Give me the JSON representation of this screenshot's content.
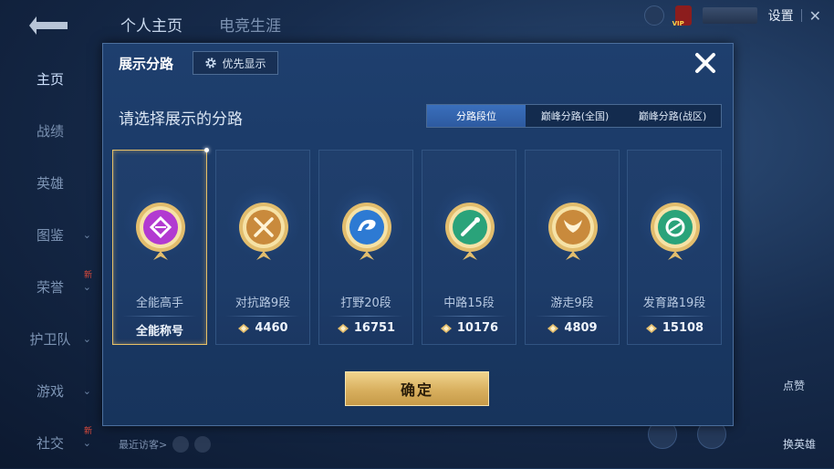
{
  "top_tabs": [
    "个人主页",
    "电竞生涯"
  ],
  "settings_label": "设置",
  "vip_label": "VIP",
  "sidebar": [
    {
      "label": "主页",
      "has_chevron": false
    },
    {
      "label": "战绩",
      "has_chevron": false
    },
    {
      "label": "英雄",
      "has_chevron": false
    },
    {
      "label": "图鉴",
      "has_chevron": true
    },
    {
      "label": "荣誉",
      "has_chevron": true,
      "badge": "新"
    },
    {
      "label": "护卫队",
      "has_chevron": true
    },
    {
      "label": "游戏",
      "has_chevron": true
    },
    {
      "label": "社交",
      "has_chevron": true,
      "badge": "新"
    }
  ],
  "recent_visitors_label": "最近访客>",
  "right_labels": [
    "点赞",
    "换英雄"
  ],
  "modal": {
    "title": "展示分路",
    "priority_label": "优先显示",
    "subtitle": "请选择展示的分路",
    "segments": [
      {
        "label": "分路段位",
        "active": true
      },
      {
        "label": "巅峰分路(全国)",
        "active": false
      },
      {
        "label": "巅峰分路(战区)",
        "active": false
      }
    ],
    "cards": [
      {
        "name": "全能高手",
        "value": "全能称号",
        "show_points_icon": false,
        "selected": true,
        "badge_color": "#b23ad1",
        "icon": "diamond-icon"
      },
      {
        "name": "对抗路9段",
        "value": "4460",
        "show_points_icon": true,
        "selected": false,
        "badge_color": "#c98a3c",
        "icon": "crossed-swords-icon"
      },
      {
        "name": "打野20段",
        "value": "16751",
        "show_points_icon": true,
        "selected": false,
        "badge_color": "#2d7ad3",
        "icon": "dragon-icon"
      },
      {
        "name": "中路15段",
        "value": "10176",
        "show_points_icon": true,
        "selected": false,
        "badge_color": "#2aa37a",
        "icon": "staff-icon"
      },
      {
        "name": "游走9段",
        "value": "4809",
        "show_points_icon": true,
        "selected": false,
        "badge_color": "#c98a3c",
        "icon": "wings-icon"
      },
      {
        "name": "发育路19段",
        "value": "15108",
        "show_points_icon": true,
        "selected": false,
        "badge_color": "#2aa37a",
        "icon": "target-icon"
      }
    ],
    "confirm_label": "确定"
  },
  "colors": {
    "accent_gold": "#e2bd6d",
    "active_segment": "#3a6fbc",
    "modal_bg": "#1e3f6e"
  }
}
